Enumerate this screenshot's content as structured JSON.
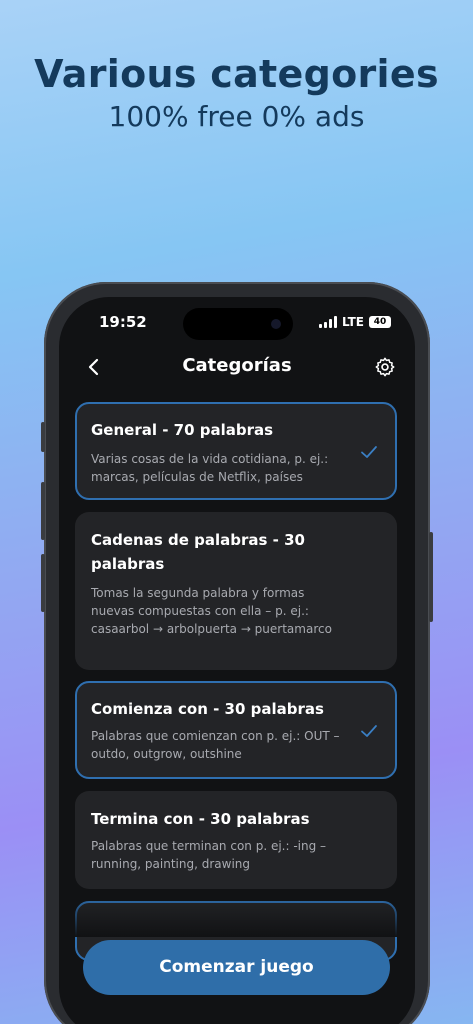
{
  "promo": {
    "title": "Various categories",
    "subtitle": "100% free 0% ads"
  },
  "status_bar": {
    "time": "19:52",
    "network": "LTE",
    "battery": "40"
  },
  "nav": {
    "title": "Categorías",
    "back_icon": "chevron-left-icon",
    "settings_icon": "gear-icon"
  },
  "categories": [
    {
      "title": "General - 70 palabras",
      "description": "Varias cosas de la vida cotidiana, p. ej.: marcas, películas de Netflix, países",
      "selected": true
    },
    {
      "title": "Cadenas de palabras - 30 palabras",
      "description": "Tomas la segunda palabra y formas nuevas compuestas con ella – p. ej.: casaarbol → arbolpuerta → puertamarco",
      "selected": false
    },
    {
      "title": "Comienza con - 30 palabras",
      "description": "Palabras que comienzan con p. ej.: OUT – outdo, outgrow, outshine",
      "selected": true
    },
    {
      "title": "Termina con - 30 palabras",
      "description": "Palabras que terminan con p. ej.: -ing – running, painting, drawing",
      "selected": false
    }
  ],
  "start_button": {
    "label": "Comenzar juego"
  },
  "colors": {
    "accent": "#2f6ea9",
    "selected_border": "#2f6fb0",
    "card_bg": "#232427",
    "screen_bg": "#111214"
  }
}
